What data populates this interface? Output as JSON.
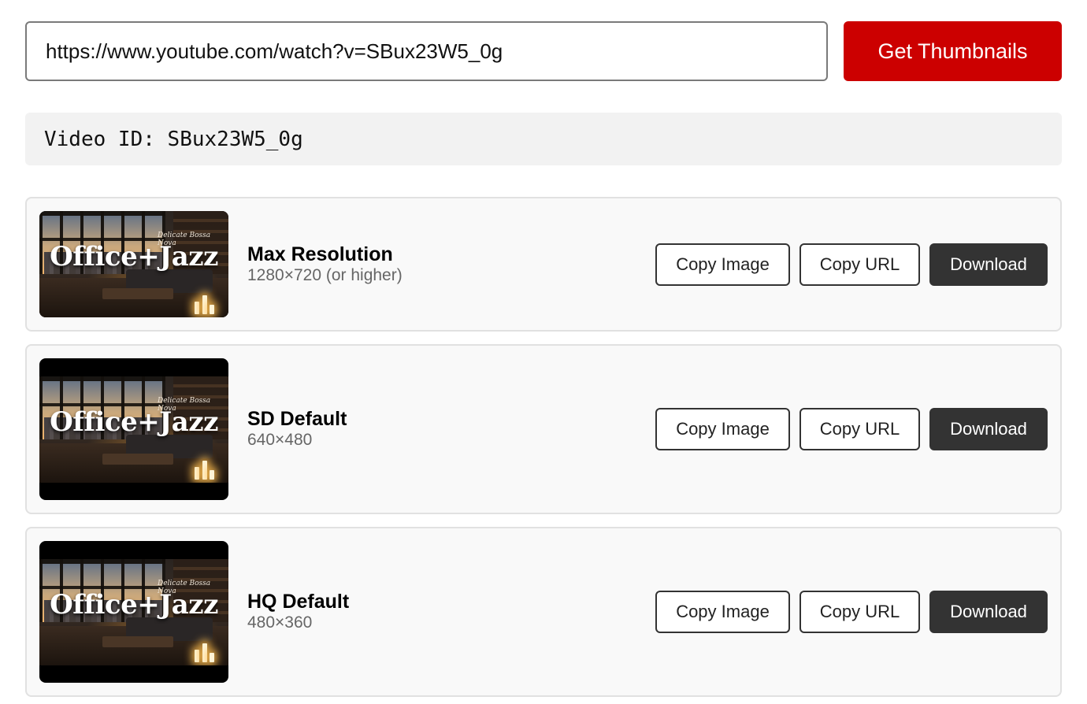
{
  "search": {
    "url_value": "https://www.youtube.com/watch?v=SBux23W5_0g",
    "button_label": "Get Thumbnails"
  },
  "video_id": {
    "label": "Video ID:",
    "value": "SBux23W5_0g"
  },
  "thumbnail_text": {
    "headline": "Office+Jazz",
    "script": "Delicate Bossa Nova"
  },
  "thumbnails": [
    {
      "title": "Max Resolution",
      "resolution": "1280×720 (or higher)",
      "copy_image_label": "Copy Image",
      "copy_url_label": "Copy URL",
      "download_label": "Download"
    },
    {
      "title": "SD Default",
      "resolution": "640×480",
      "copy_image_label": "Copy Image",
      "copy_url_label": "Copy URL",
      "download_label": "Download"
    },
    {
      "title": "HQ Default",
      "resolution": "480×360",
      "copy_image_label": "Copy Image",
      "copy_url_label": "Copy URL",
      "download_label": "Download"
    }
  ],
  "colors": {
    "accent": "#cc0000",
    "download_bg": "#333333"
  },
  "icons": {
    "thumbnail": "thumbnail-image"
  }
}
